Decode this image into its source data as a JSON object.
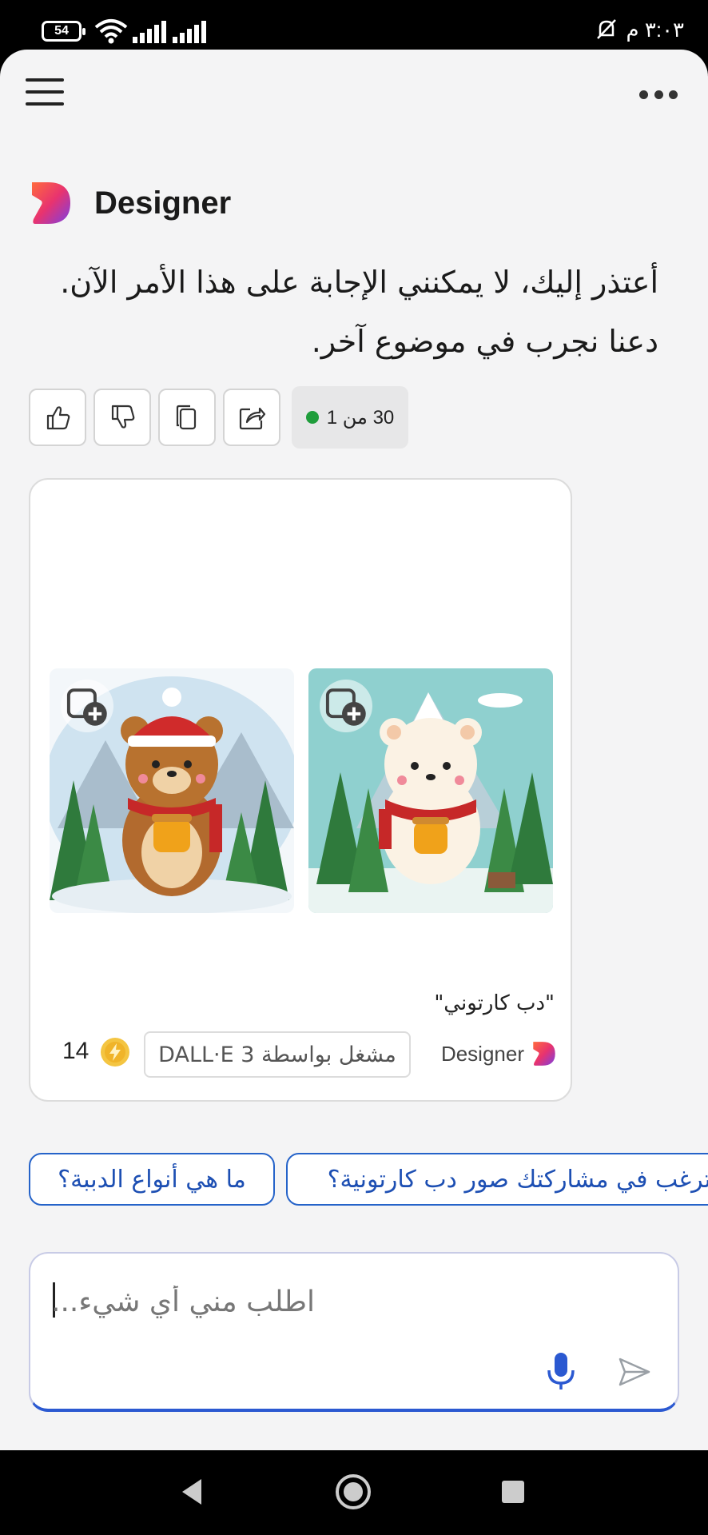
{
  "status_bar": {
    "battery": "54",
    "time": "٣:٠٣ م"
  },
  "header": {
    "menu_icon": "hamburger-icon",
    "more_icon": "more-horizontal-icon"
  },
  "message": {
    "sender": "Designer",
    "text": "أعتذر إليك، لا يمكنني الإجابة على هذا الأمر الآن. دعنا نجرب في موضوع آخر.",
    "counter": "30 من 1",
    "actions": [
      "thumbs-up-icon",
      "thumbs-down-icon",
      "copy-icon",
      "share-icon"
    ]
  },
  "image_card": {
    "caption": "\"دب كارتوني\"",
    "credits": "14",
    "powered_by": "مشغل بواسطة DALL·E 3",
    "brand": "Designer"
  },
  "suggestions": [
    "ما هي أنواع الدببة؟",
    "ترغب في مشاركتك صور دب كارتونية؟"
  ],
  "input": {
    "placeholder": "اطلب مني أي شيء..."
  },
  "colors": {
    "accent": "#2563c9",
    "status_dot": "#1f9d3b",
    "background": "#f4f4f5"
  }
}
